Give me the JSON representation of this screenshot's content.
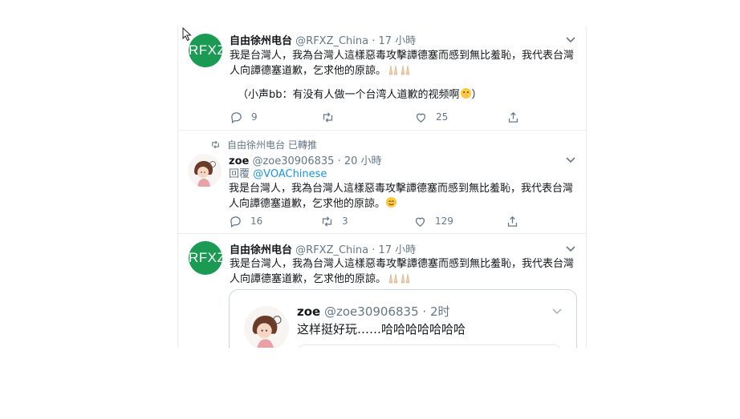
{
  "tweets": [
    {
      "name": "自由徐州电台",
      "handle": "@RFXZ_China",
      "time": "· 17 小時",
      "avatar_text": "RFXZ",
      "body_line1": "我是台灣人，我為台灣人這樣惡毒攻擊譚德塞而感到無比羞恥，我代表台灣",
      "body_line2": "人向譚德塞道歉，乞求他的原諒。",
      "extra": "（小声bb：有没有人做一个台湾人道歉的视频啊",
      "extra_end": "）",
      "reply_count": "9",
      "retweet_count": "",
      "like_count": "25"
    },
    {
      "retweeted_by": "自由徐州电台 已轉推",
      "name": "zoe",
      "handle": "@zoe30906835",
      "time": "· 20 小時",
      "reply_to_label": "回覆",
      "reply_to_handle": "@VOAChinese",
      "body_line1": "我是台灣人，我為台灣人這樣惡毒攻擊譚德塞而感到無比羞恥，我代表台灣",
      "body_line2": "人向譚德塞道歉，乞求他的原諒。",
      "reply_count": "16",
      "retweet_count": "3",
      "like_count": "129"
    },
    {
      "name": "自由徐州电台",
      "handle": "@RFXZ_China",
      "time": "· 17 小時",
      "avatar_text": "RFXZ",
      "body_line1": "我是台灣人，我為台灣人這樣惡毒攻擊譚德塞而感到無比羞恥，我代表台灣",
      "body_line2": "人向譚德塞道歉，乞求他的原諒。"
    }
  ],
  "quote": {
    "name": "zoe",
    "handle": "@zoe30906835",
    "time": "· 2时",
    "body": "这样挺好玩……哈哈哈哈哈哈哈"
  },
  "colors": {
    "accent": "#1b95e0",
    "avatar_green": "#1a9a52",
    "muted": "#657786",
    "border": "#e6ecf0"
  },
  "icons": [
    "reply-icon",
    "retweet-icon",
    "like-icon",
    "share-icon",
    "chevron-down-icon",
    "pray-emoji",
    "shush-emoji",
    "smile-emoji",
    "cursor-icon"
  ]
}
